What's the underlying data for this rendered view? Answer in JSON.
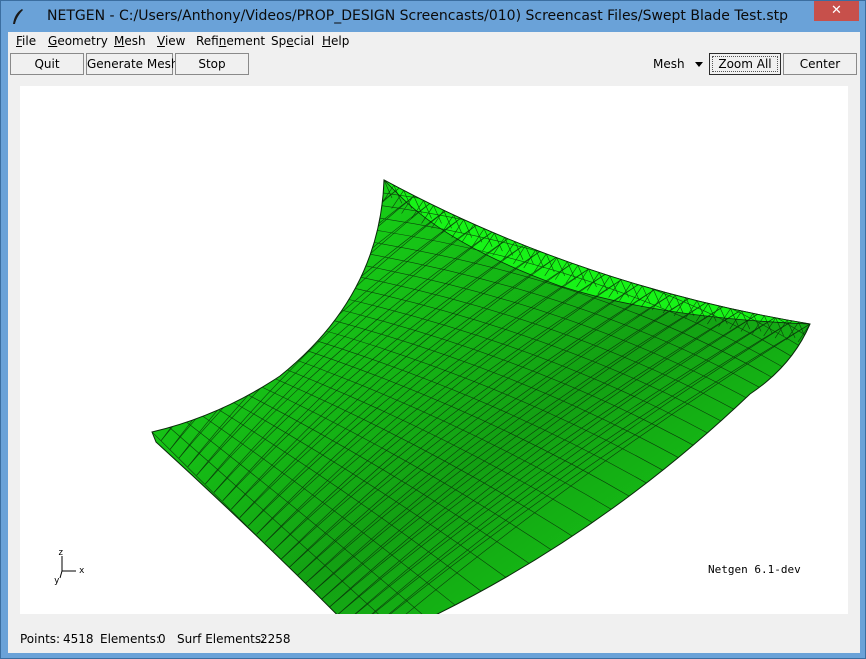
{
  "window": {
    "title": "NETGEN - C:/Users/Anthony/Videos/PROP_DESIGN Screencasts/010) Screencast Files/Swept Blade Test.stp",
    "close_glyph": "✕"
  },
  "menu": [
    {
      "pre": "",
      "ul": "F",
      "post": "ile"
    },
    {
      "pre": "",
      "ul": "G",
      "post": "eometry"
    },
    {
      "pre": "",
      "ul": "M",
      "post": "esh"
    },
    {
      "pre": "",
      "ul": "V",
      "post": "iew"
    },
    {
      "pre": "Refi",
      "ul": "n",
      "post": "ement"
    },
    {
      "pre": "Sp",
      "ul": "e",
      "post": "cial"
    },
    {
      "pre": "",
      "ul": "H",
      "post": "elp"
    }
  ],
  "toolbar": {
    "quit": "Quit",
    "generate_mesh": "Generate Mesh",
    "stop": "Stop",
    "mode_value": "Mesh",
    "zoom_all": "Zoom All",
    "center": "Center"
  },
  "viewport": {
    "version": "Netgen 6.1-dev",
    "axis": {
      "z": "z",
      "x": "x",
      "y": "y"
    },
    "mesh_colors": {
      "fill_light": "#17f317",
      "fill_dark": "#149a14",
      "edge": "#0a2a0a"
    }
  },
  "status": {
    "points_label": "Points:",
    "points_value": "4518",
    "elements_label": "Elements:",
    "elements_value": "0",
    "surf_elements_label": "Surf Elements:",
    "surf_elements_value": "2258"
  }
}
